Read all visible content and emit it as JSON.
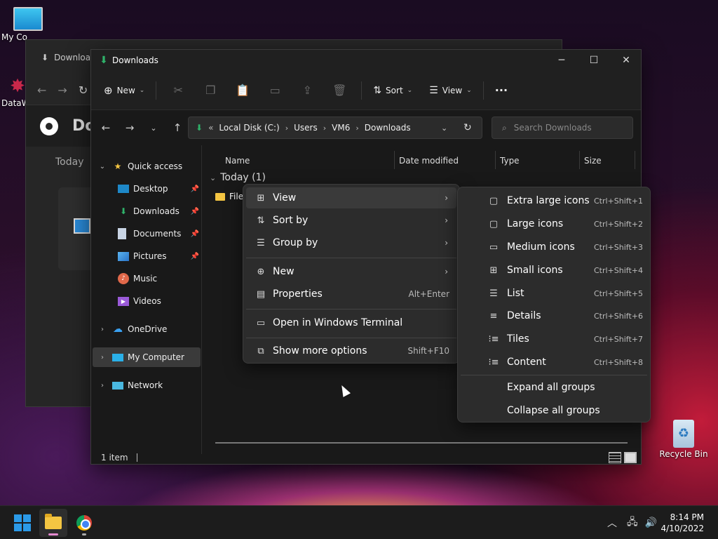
{
  "desktop": {
    "icons": [
      {
        "label": "My Co"
      },
      {
        "label": "DataW"
      },
      {
        "label": "Recycle Bin"
      }
    ]
  },
  "bg_window": {
    "title": "Downloa",
    "chrome_title": "Do",
    "today": "Today"
  },
  "window": {
    "title": "Downloads",
    "controls": {
      "minimize": "─",
      "maximize": "☐",
      "close": "✕"
    }
  },
  "toolbar": {
    "new_label": "New",
    "sort_label": "Sort",
    "view_label": "View",
    "more_label": "···"
  },
  "address": {
    "overflow": "«",
    "segments": [
      "Local Disk (C:)",
      "Users",
      "VM6",
      "Downloads"
    ],
    "search_placeholder": "Search Downloads"
  },
  "sidebar": {
    "items": [
      {
        "label": "Quick access",
        "icon": "star-icon"
      },
      {
        "label": "Desktop",
        "icon": "desktop-icon"
      },
      {
        "label": "Downloads",
        "icon": "download-icon"
      },
      {
        "label": "Documents",
        "icon": "document-icon"
      },
      {
        "label": "Pictures",
        "icon": "picture-icon"
      },
      {
        "label": "Music",
        "icon": "music-icon"
      },
      {
        "label": "Videos",
        "icon": "video-icon"
      },
      {
        "label": "OneDrive",
        "icon": "cloud-icon"
      },
      {
        "label": "My Computer",
        "icon": "computer-icon"
      },
      {
        "label": "Network",
        "icon": "network-icon"
      }
    ]
  },
  "columns": [
    "Name",
    "Date modified",
    "Type",
    "Size"
  ],
  "group": {
    "label": "Today (1)"
  },
  "file": {
    "name": "File"
  },
  "status": {
    "count": "1 item"
  },
  "context_menu": {
    "items": [
      {
        "label": "View",
        "icon": "grid-icon"
      },
      {
        "label": "Sort by",
        "icon": "sort-icon"
      },
      {
        "label": "Group by",
        "icon": "group-icon"
      },
      {
        "label": "New",
        "icon": "plus-circle-icon"
      },
      {
        "label": "Properties",
        "icon": "properties-icon",
        "shortcut": "Alt+Enter"
      },
      {
        "label": "Open in Windows Terminal",
        "icon": "terminal-icon"
      },
      {
        "label": "Show more options",
        "icon": "more-options-icon",
        "shortcut": "Shift+F10"
      }
    ]
  },
  "view_submenu": {
    "items": [
      {
        "label": "Extra large icons",
        "shortcut": "Ctrl+Shift+1"
      },
      {
        "label": "Large icons",
        "shortcut": "Ctrl+Shift+2"
      },
      {
        "label": "Medium icons",
        "shortcut": "Ctrl+Shift+3"
      },
      {
        "label": "Small icons",
        "shortcut": "Ctrl+Shift+4"
      },
      {
        "label": "List",
        "shortcut": "Ctrl+Shift+5"
      },
      {
        "label": "Details",
        "shortcut": "Ctrl+Shift+6"
      },
      {
        "label": "Tiles",
        "shortcut": "Ctrl+Shift+7"
      },
      {
        "label": "Content",
        "shortcut": "Ctrl+Shift+8"
      },
      {
        "label": "Expand all groups"
      },
      {
        "label": "Collapse all groups"
      }
    ]
  },
  "taskbar": {
    "time": "8:14 PM",
    "date": "4/10/2022"
  },
  "colors": {
    "accent": "#2fb36a",
    "menu_bg": "#2c2c2c",
    "window_bg": "#191919"
  }
}
